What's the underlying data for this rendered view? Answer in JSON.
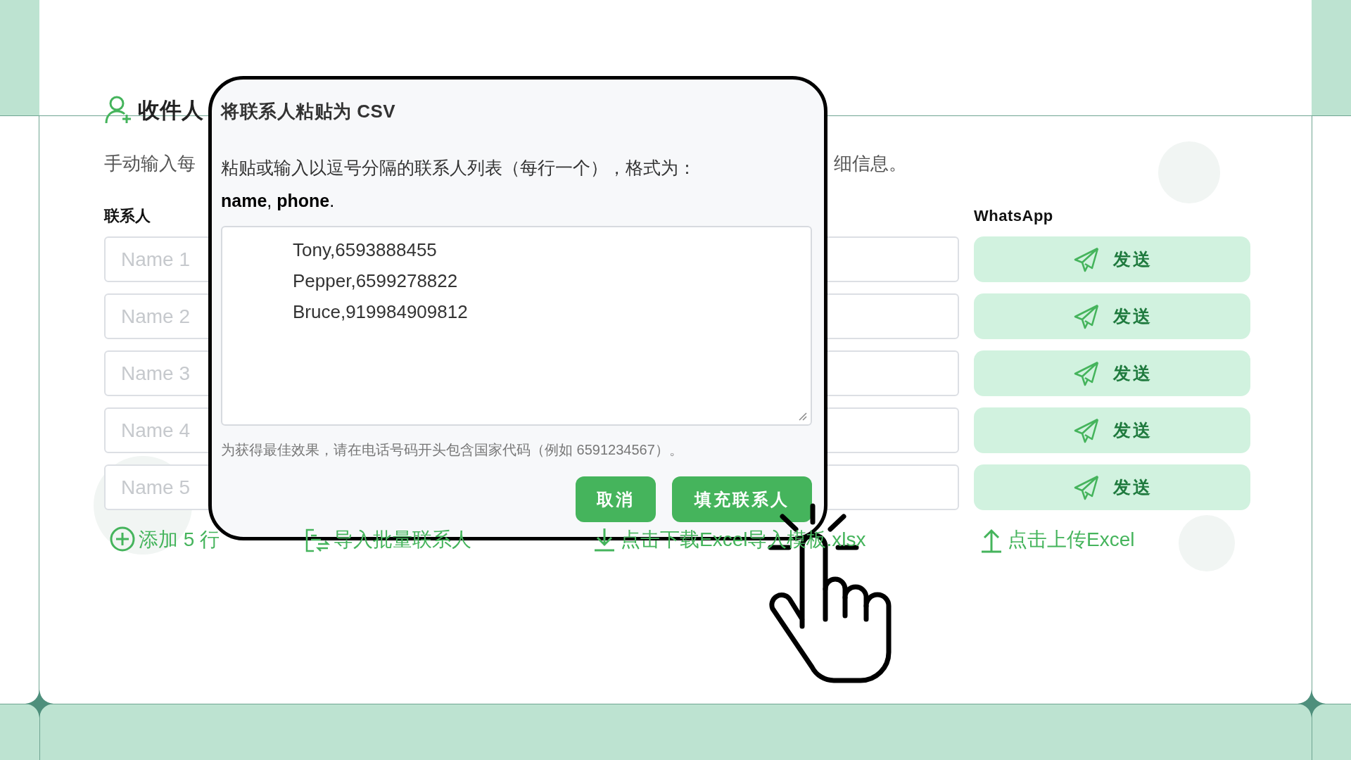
{
  "page": {
    "title": "收件人",
    "description_start": "手动输入每",
    "description_end": "细信息。",
    "contacts_label": "联系人",
    "whatsapp_label": "WhatsApp",
    "rows": [
      {
        "name_placeholder": "Name 1",
        "send_button": "发送"
      },
      {
        "name_placeholder": "Name 2",
        "send_button": "发送"
      },
      {
        "name_placeholder": "Name 3",
        "send_button": "发送"
      },
      {
        "name_placeholder": "Name 4",
        "send_button": "发送"
      },
      {
        "name_placeholder": "Name 5",
        "send_button": "发送"
      }
    ],
    "links": [
      {
        "kind": "add",
        "label": "添加 5 行"
      },
      {
        "kind": "import",
        "label": "导入批量联系人"
      },
      {
        "kind": "download",
        "label": "点击下载Excel导入模板.xlsx"
      },
      {
        "kind": "upload",
        "label": "点击上传Excel"
      }
    ]
  },
  "dialog": {
    "title": "将联系人粘贴为 CSV",
    "instruction": "粘贴或输入以逗号分隔的联系人列表（每行一个），格式为：",
    "format": "**name**, **phone**.",
    "textarea_value": "Tony,6593888455\nPepper,6599278822\nBruce,919984909812",
    "hint": "为获得最佳效果，请在电话号码开头包含国家代码（例如 6591234567）。",
    "buttons": [
      {
        "kind": "cancel",
        "label": "取消"
      },
      {
        "kind": "confirm",
        "label": "填充联系人"
      }
    ]
  }
}
